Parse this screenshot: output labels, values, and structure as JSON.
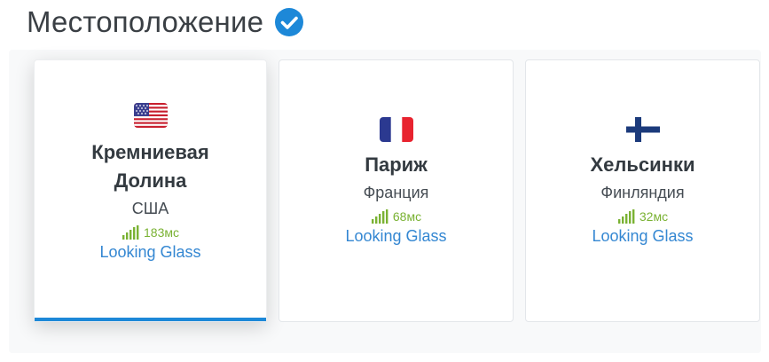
{
  "header": {
    "title": "Местоположение"
  },
  "locations": [
    {
      "city": "Кремниевая Долина",
      "country": "США",
      "ping": "183мс",
      "link": "Looking Glass",
      "flag": "us-flag-icon",
      "selected": true
    },
    {
      "city": "Париж",
      "country": "Франция",
      "ping": "68мс",
      "link": "Looking Glass",
      "flag": "fr-flag-icon",
      "selected": false
    },
    {
      "city": "Хельсинки",
      "country": "Финляндия",
      "ping": "32мс",
      "link": "Looking Glass",
      "flag": "fi-flag-icon",
      "selected": false
    }
  ],
  "colors": {
    "accent": "#1d88d8",
    "ping": "#7ab233",
    "link": "#3487d2",
    "verified": "#1d88d8"
  }
}
